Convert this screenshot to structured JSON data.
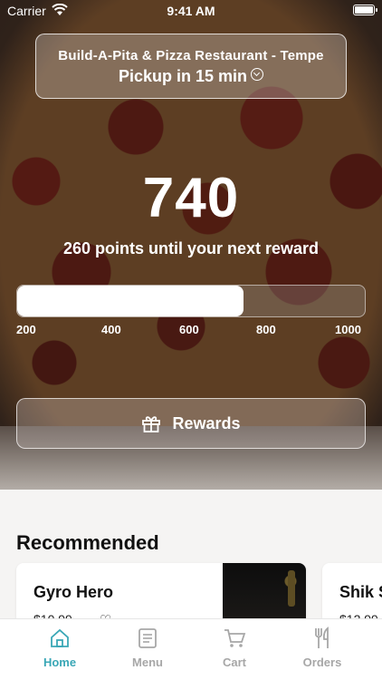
{
  "status_bar": {
    "carrier": "Carrier",
    "time": "9:41 AM"
  },
  "store": {
    "name": "Build-A-Pita & Pizza Restaurant - Tempe",
    "pickup": "Pickup in 15 min"
  },
  "rewards": {
    "points": "740",
    "until_text": "260 points until your next reward",
    "progress_fraction": 0.65,
    "ticks": [
      "200",
      "400",
      "600",
      "800",
      "1000"
    ],
    "button_label": "Rewards"
  },
  "recommended": {
    "title": "Recommended",
    "items": [
      {
        "name": "Gyro Hero",
        "price": "$10.99"
      },
      {
        "name": "Shik S",
        "price": "$12.99"
      }
    ]
  },
  "tabbar": {
    "items": [
      {
        "label": "Home",
        "icon": "home-icon",
        "active": true
      },
      {
        "label": "Menu",
        "icon": "menu-icon",
        "active": false
      },
      {
        "label": "Cart",
        "icon": "cart-icon",
        "active": false
      },
      {
        "label": "Orders",
        "icon": "orders-icon",
        "active": false
      }
    ]
  },
  "colors": {
    "accent": "#3aa7b6",
    "tab_inactive": "#a7a7a7"
  }
}
